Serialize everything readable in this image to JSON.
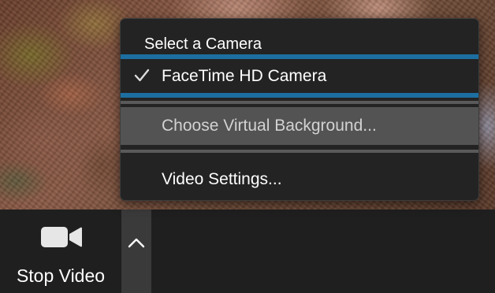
{
  "camera_menu": {
    "header": "Select a Camera",
    "cameras": [
      {
        "label": "FaceTime HD Camera",
        "selected": true
      }
    ],
    "items": [
      {
        "label": "Choose Virtual Background..."
      },
      {
        "label": "Video Settings..."
      }
    ]
  },
  "toolbar": {
    "stop_video_label": "Stop Video"
  },
  "icons": {
    "check": "check-icon",
    "camera": "video-camera-icon",
    "caret": "chevron-up-icon"
  },
  "colors": {
    "selection_accent": "#1c6fa0",
    "menu_background": "#232323",
    "hover_item_background": "#535353",
    "toolbar_background": "#1f1f1f"
  }
}
